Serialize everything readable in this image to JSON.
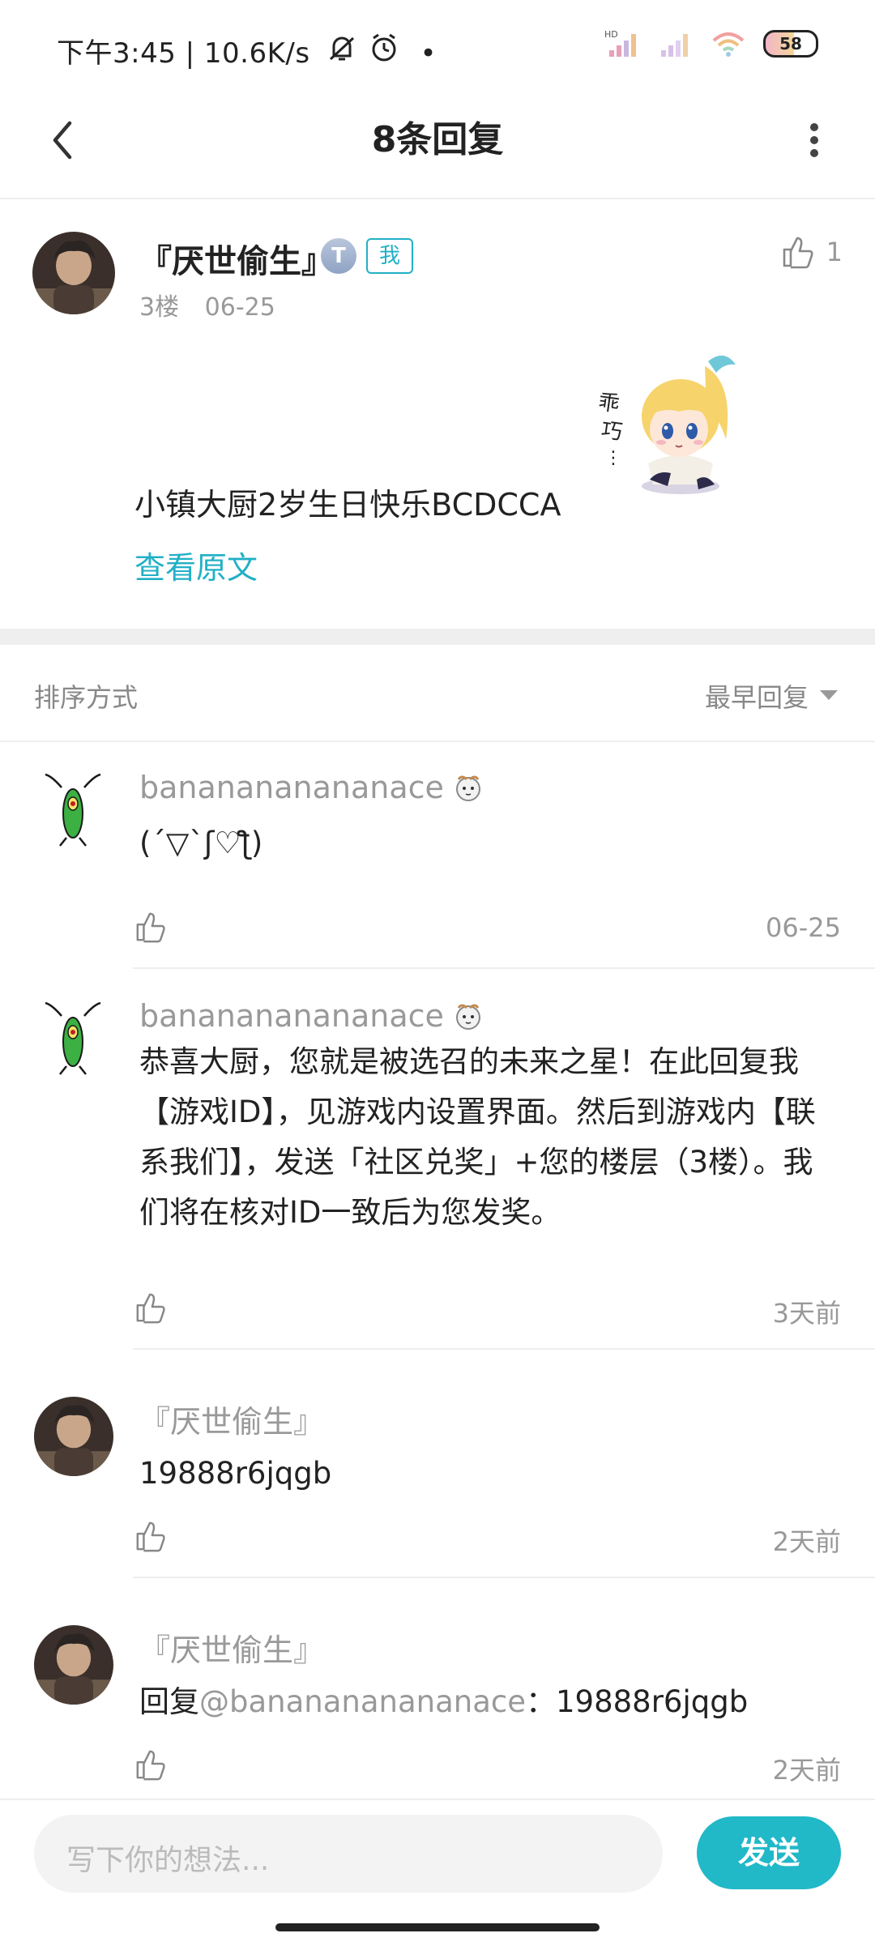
{
  "status_bar": {
    "time_text": "下午3:45 | 10.6K/s",
    "battery": "58"
  },
  "header": {
    "title": "8条回复"
  },
  "post": {
    "author": "『厌世偷生』",
    "level_badge": "T",
    "me_badge": "我",
    "floor": "3楼",
    "date": "06-25",
    "like_count": "1",
    "text": "小镇大厨2岁生日快乐BCDCCA",
    "view_original": "查看原文"
  },
  "sort": {
    "label": "排序方式",
    "value": "最早回复"
  },
  "replies": [
    {
      "author": "bananananananace",
      "text": "(´▽`ʃ♡ƪ)",
      "time": "06-25"
    },
    {
      "author": "bananananananace",
      "text": "恭喜大厨，您就是被选召的未来之星！在此回复我【游戏ID】，见游戏内设置界面。然后到游戏内【联系我们】，发送「社区兑奖」+您的楼层（3楼）。我们将在核对ID一致后为您发奖。",
      "time": "3天前"
    },
    {
      "author": "『厌世偷生』",
      "text": "19888r6jqgb",
      "time": "2天前"
    },
    {
      "author": "『厌世偷生』",
      "reply_prefix": "回复",
      "mention": "@bananananananace",
      "reply_rest": "：19888r6jqgb",
      "time": "2天前"
    }
  ],
  "bottom_bar": {
    "placeholder": "写下你的想法...",
    "send_label": "发送"
  },
  "colors": {
    "accent": "#21b8c8",
    "muted_text": "#999999"
  }
}
